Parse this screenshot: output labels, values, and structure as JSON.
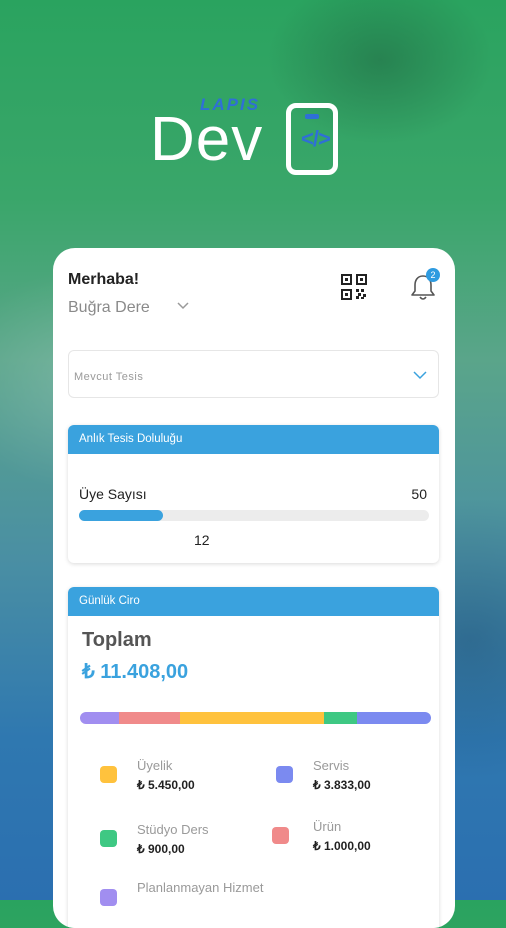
{
  "logo": {
    "brand_small": "LAPIS",
    "brand_big": "Dev",
    "code_glyph": "</>"
  },
  "header": {
    "greeting": "Merhaba!",
    "user_name": "Buğra Dere",
    "notification_count": "2"
  },
  "facility_select": {
    "placeholder": "Mevcut Tesis"
  },
  "occupancy": {
    "title": "Anlık Tesis Doluluğu",
    "label": "Üye Sayısı",
    "max": "50",
    "current": "12",
    "ratio": 0.24
  },
  "revenue": {
    "title": "Günlük Ciro",
    "total_label": "Toplam",
    "total_value": "₺ 11.408,00",
    "segments": [
      {
        "color": "#a18ef0",
        "share": 0.11
      },
      {
        "color": "#f08a8a",
        "share": 0.175
      },
      {
        "color": "#ffc23d",
        "share": 0.41
      },
      {
        "color": "#3ec883",
        "share": 0.095
      },
      {
        "color": "#7b8af0",
        "share": 0.21
      }
    ],
    "legend": [
      {
        "name": "Üyelik",
        "value": "₺ 5.450,00",
        "color": "#ffc23d"
      },
      {
        "name": "Servis",
        "value": "₺ 3.833,00",
        "color": "#7b8af0"
      },
      {
        "name": "Stüdyo Ders",
        "value": "₺ 900,00",
        "color": "#3ec883"
      },
      {
        "name": "Ürün",
        "value": "₺ 1.000,00",
        "color": "#f08a8a"
      },
      {
        "name": "Planlanmayan Hizmet",
        "value": "",
        "color": "#a18ef0"
      }
    ]
  },
  "colors": {
    "accent": "#3aa2de"
  }
}
